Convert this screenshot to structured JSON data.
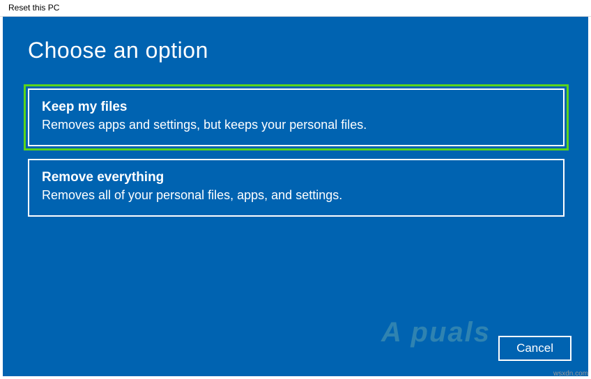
{
  "titlebar": {
    "title": "Reset this PC"
  },
  "heading": "Choose an option",
  "options": [
    {
      "title": "Keep my files",
      "description": "Removes apps and settings, but keeps your personal files.",
      "highlighted": true
    },
    {
      "title": "Remove everything",
      "description": "Removes all of your personal files, apps, and settings.",
      "highlighted": false
    }
  ],
  "footer": {
    "cancel_label": "Cancel"
  },
  "watermark": {
    "logo_text": "A  puals",
    "site_text": "wsxdn.com"
  },
  "colors": {
    "panel_bg": "#0063B1",
    "highlight_border": "#5bd41b"
  }
}
